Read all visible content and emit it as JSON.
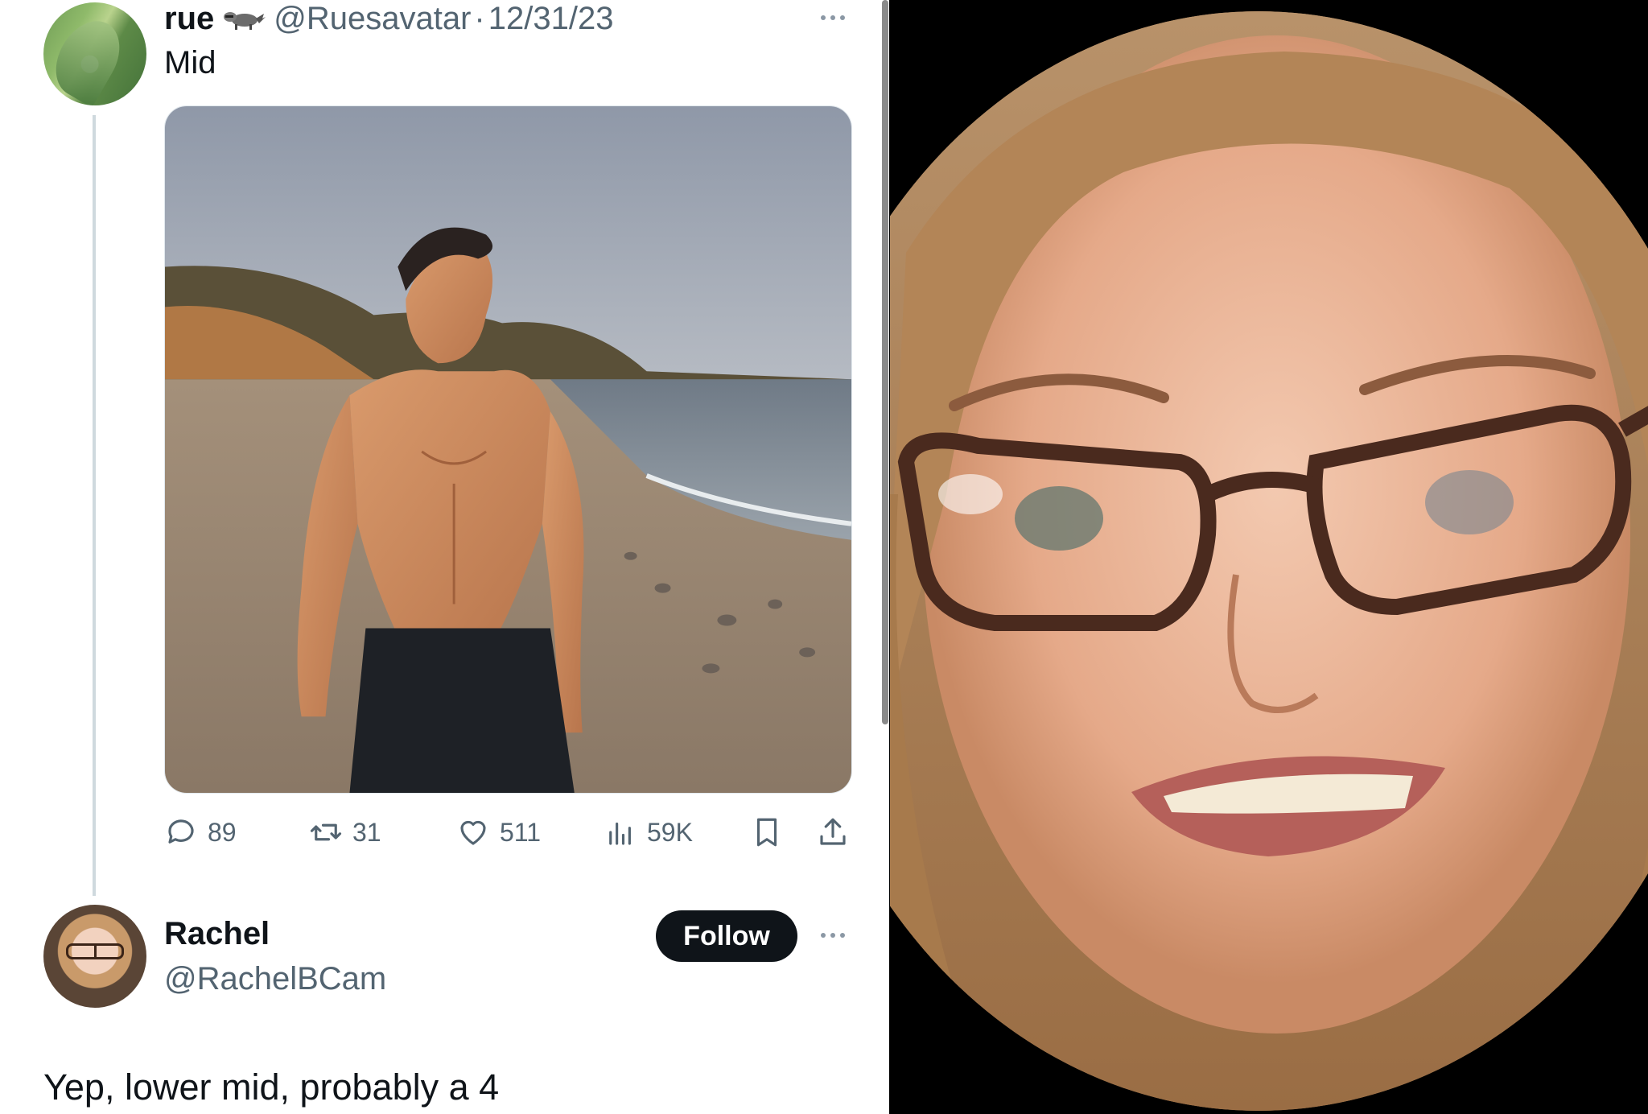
{
  "tweet": {
    "author_name": "rue",
    "author_icon": "raccoon-emoji",
    "author_handle": "@Ruesavatar",
    "separator": "·",
    "date": "12/31/23",
    "text": "Mid",
    "media": "shirtless-man-on-beach-photo",
    "stats": {
      "replies": "89",
      "reposts": "31",
      "likes": "511",
      "views": "59K"
    }
  },
  "reply": {
    "author_name": "Rachel",
    "author_handle": "@RachelBCam",
    "follow_label": "Follow",
    "text": "Yep, lower mid, probably a 4"
  },
  "right_panel": {
    "content": "circular-profile-photo"
  },
  "colors": {
    "text_primary": "#0f1419",
    "text_secondary": "#536471",
    "follow_bg": "#0f1419",
    "thread_line": "#cfd9de"
  }
}
